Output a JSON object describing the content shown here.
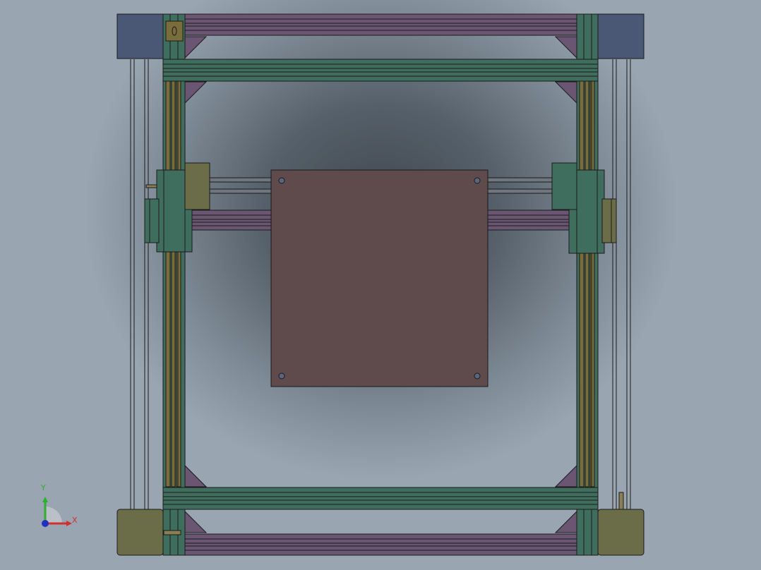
{
  "viewport": {
    "background_center": "#3f4850",
    "background_edge": "#99a5b1"
  },
  "colors": {
    "motor_blue": "#4a5775",
    "motor_olive": "#6b6d48",
    "extrusion_green": "#3f6e5f",
    "extrusion_purple": "#6a5572",
    "rod_gold": "#7a6d3c",
    "bed_plate": "#5f4b4b",
    "bolt": "#5a6680"
  },
  "triad": {
    "y_label": "Y",
    "x_label": "X",
    "y_color": "#2fae2f",
    "x_color": "#d03030",
    "z_color": "#2030c0"
  },
  "icons": {
    "view_triad": "axis-triad-icon"
  }
}
